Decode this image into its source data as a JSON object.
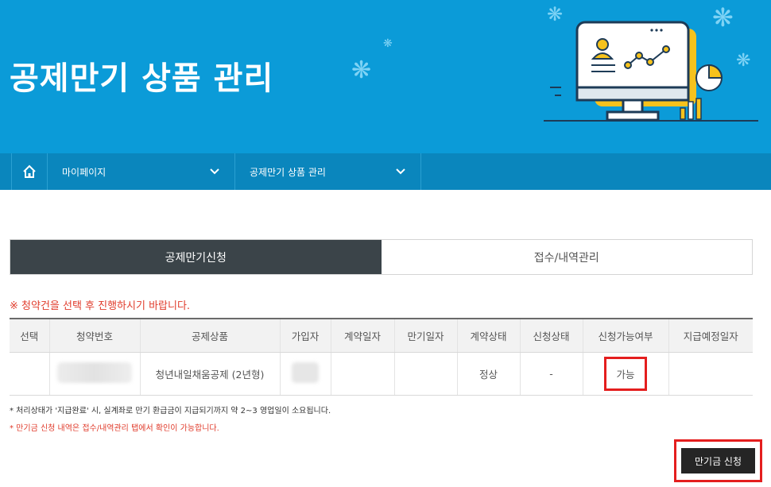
{
  "banner": {
    "title": "공제만기 상품 관리",
    "illustration_icon": "computer-chart-illustration"
  },
  "nav": {
    "home_icon": "home-icon",
    "menu1": "마이페이지",
    "menu2": "공제만기 상품 관리"
  },
  "tabs": [
    {
      "label": "공제만기신청",
      "active": true
    },
    {
      "label": "접수/내역관리",
      "active": false
    }
  ],
  "notice_top": "※ 청약건을 선택 후 진행하시기 바랍니다.",
  "table": {
    "headers": [
      "선택",
      "청약번호",
      "공제상품",
      "가입자",
      "계약일자",
      "만기일자",
      "계약상태",
      "신청상태",
      "신청가능여부",
      "지급예정일자"
    ],
    "rows": [
      {
        "select": "",
        "contract_no": "",
        "product": "청년내일채움공제 (2년형)",
        "subscriber": "",
        "contract_date": "",
        "maturity_date": "",
        "contract_status": "정상",
        "apply_status": "-",
        "available": "가능",
        "payment_date": ""
      }
    ]
  },
  "note1": "* 처리상태가 '지급완료' 시, 실계좌로 만기 환급금이 지급되기까지 약 2~3 영업일이 소요됩니다.",
  "note2": "* 만기금 신청 내역은 접수/내역관리 탭에서 확인이 가능합니다.",
  "apply_button": "만기금 신청",
  "colors": {
    "banner": "#0b9bd8",
    "navbar": "#0a86bd",
    "active_tab": "#3b4449",
    "notice_red": "#e03b2b",
    "highlight_red": "#e41e1e"
  }
}
